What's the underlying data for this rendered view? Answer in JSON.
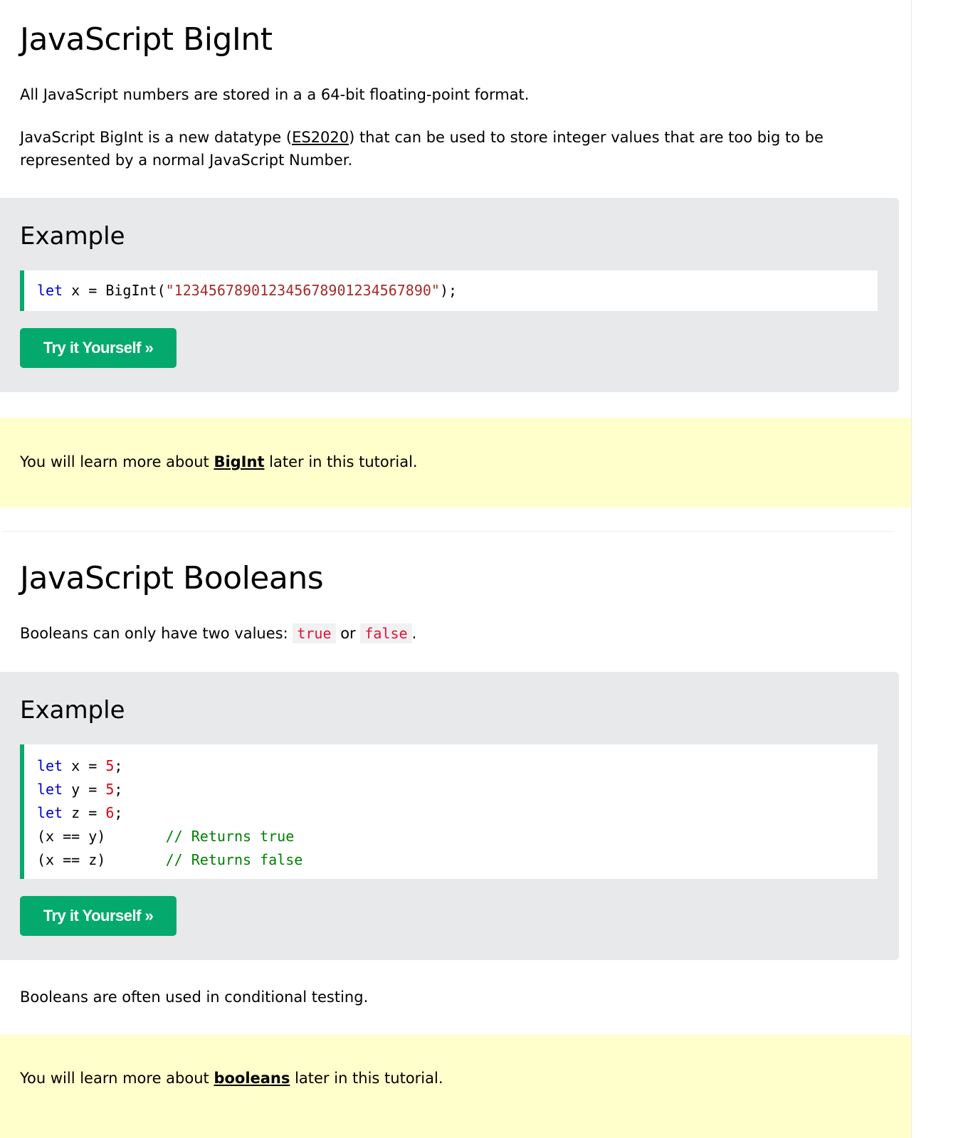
{
  "bigint": {
    "title": "JavaScript BigInt",
    "para1": "All JavaScript numbers are stored in a a 64-bit floating-point format.",
    "para2_before": "JavaScript BigInt is a new datatype (",
    "para2_link": "ES2020",
    "para2_after": ") that can be used to store integer values that are too big to be represented by a normal JavaScript Number.",
    "example": {
      "heading": "Example",
      "code": {
        "kw": "let",
        "mid": " x = BigInt(",
        "str": "\"123456789012345678901234567890\"",
        "end": ");"
      },
      "button": "Try it Yourself »"
    },
    "note": {
      "before": "You will learn more about ",
      "link": "BigInt",
      "after": " later in this tutorial."
    }
  },
  "booleans": {
    "title": "JavaScript Booleans",
    "para1_before": "Booleans can only have two values: ",
    "true_value": "true",
    "para1_mid": " or ",
    "false_value": "false",
    "para1_after": ".",
    "example": {
      "heading": "Example",
      "lines": [
        {
          "kw": "let",
          "rest": " x = ",
          "num": "5",
          "end": ";"
        },
        {
          "kw": "let",
          "rest": " y = ",
          "num": "5",
          "end": ";"
        },
        {
          "kw": "let",
          "rest": " z = ",
          "num": "6",
          "end": ";"
        }
      ],
      "compare": [
        {
          "expr": "(x == y)",
          "comment": "// Returns true"
        },
        {
          "expr": "(x == z)",
          "comment": "// Returns false"
        }
      ],
      "button": "Try it Yourself »"
    },
    "para2": "Booleans are often used in conditional testing.",
    "note": {
      "before": "You will learn more about ",
      "link": "booleans",
      "after": " later in this tutorial."
    }
  },
  "colors": {
    "accent": "#04aa6d",
    "example_bg": "#e7e9eb",
    "note_bg": "#ffffcc",
    "keyword": "#0000cd",
    "string": "#a52a2a",
    "number": "#e3000f",
    "comment": "#008000"
  }
}
